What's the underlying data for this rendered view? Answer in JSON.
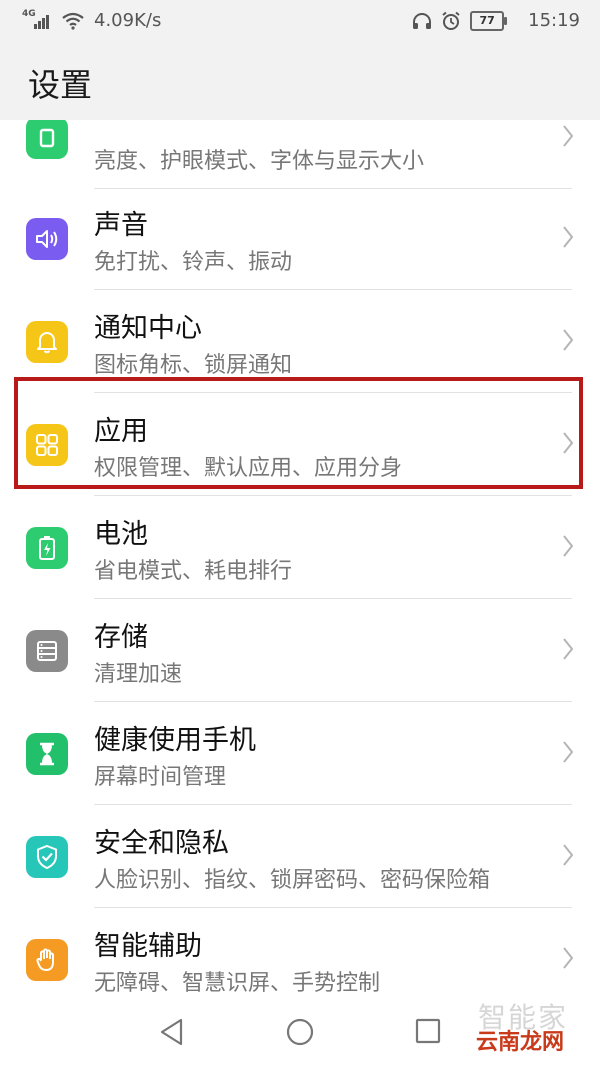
{
  "status_bar": {
    "network": "4G",
    "speed": "4.09K/s",
    "battery": "77",
    "time": "15:19"
  },
  "header": {
    "title": "设置"
  },
  "settings_items": [
    {
      "title": "",
      "subtitle": "亮度、护眼模式、字体与显示大小",
      "icon": "display-icon",
      "color": "#2ecc71"
    },
    {
      "title": "声音",
      "subtitle": "免打扰、铃声、振动",
      "icon": "speaker-icon",
      "color": "#7b5cf0"
    },
    {
      "title": "通知中心",
      "subtitle": "图标角标、锁屏通知",
      "icon": "bell-icon",
      "color": "#f5c518"
    },
    {
      "title": "应用",
      "subtitle": "权限管理、默认应用、应用分身",
      "icon": "apps-grid-icon",
      "color": "#f5c518"
    },
    {
      "title": "电池",
      "subtitle": "省电模式、耗电排行",
      "icon": "battery-icon",
      "color": "#2ecc71"
    },
    {
      "title": "存储",
      "subtitle": "清理加速",
      "icon": "storage-icon",
      "color": "#8a8a8a"
    },
    {
      "title": "健康使用手机",
      "subtitle": "屏幕时间管理",
      "icon": "hourglass-icon",
      "color": "#22c06a"
    },
    {
      "title": "安全和隐私",
      "subtitle": "人脸识别、指纹、锁屏密码、密码保险箱",
      "icon": "shield-check-icon",
      "color": "#26c6b8"
    },
    {
      "title": "智能辅助",
      "subtitle": "无障碍、智慧识屏、手势控制",
      "icon": "hand-icon",
      "color": "#f59a23"
    }
  ],
  "highlight_color": "#b81a1a",
  "watermark": {
    "text": "云南龙网",
    "faint": "智能家"
  }
}
